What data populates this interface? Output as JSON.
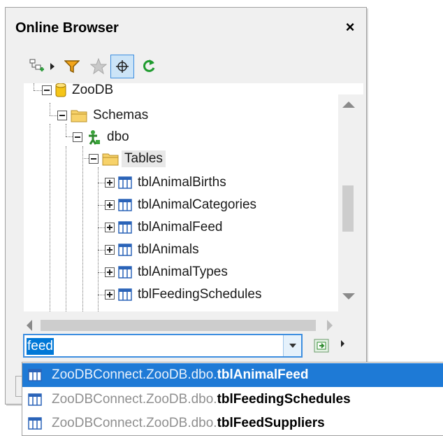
{
  "window": {
    "title": "Online Browser",
    "close_label": "×"
  },
  "toolbar": {
    "icons": [
      "add-connection-icon",
      "menu-arrow-icon",
      "filter-icon",
      "favorites-star-icon",
      "locate-target-icon",
      "refresh-icon"
    ]
  },
  "tree": {
    "root": "ZooDB",
    "schemas": "Schemas",
    "schema": "dbo",
    "tables_folder": "Tables",
    "tables": [
      "tblAnimalBirths",
      "tblAnimalCategories",
      "tblAnimalFeed",
      "tblAnimals",
      "tblAnimalTypes",
      "tblFeedingSchedules"
    ]
  },
  "search": {
    "value": "feed"
  },
  "results": [
    {
      "prefix": "ZooDBConnect.ZooDB.dbo.",
      "name": "tblAnimalFeed",
      "selected": true
    },
    {
      "prefix": "ZooDBConnect.ZooDB.dbo.",
      "name": "tblFeedingSchedules",
      "selected": false
    },
    {
      "prefix": "ZooDBConnect.ZooDB.dbo.",
      "name": "tblFeedSuppliers",
      "selected": false
    }
  ],
  "colors": {
    "selection": "#1e7ad6",
    "accent": "#3d8ee0",
    "table_icon": "#2a63b8",
    "folder": "#f2c94c"
  }
}
